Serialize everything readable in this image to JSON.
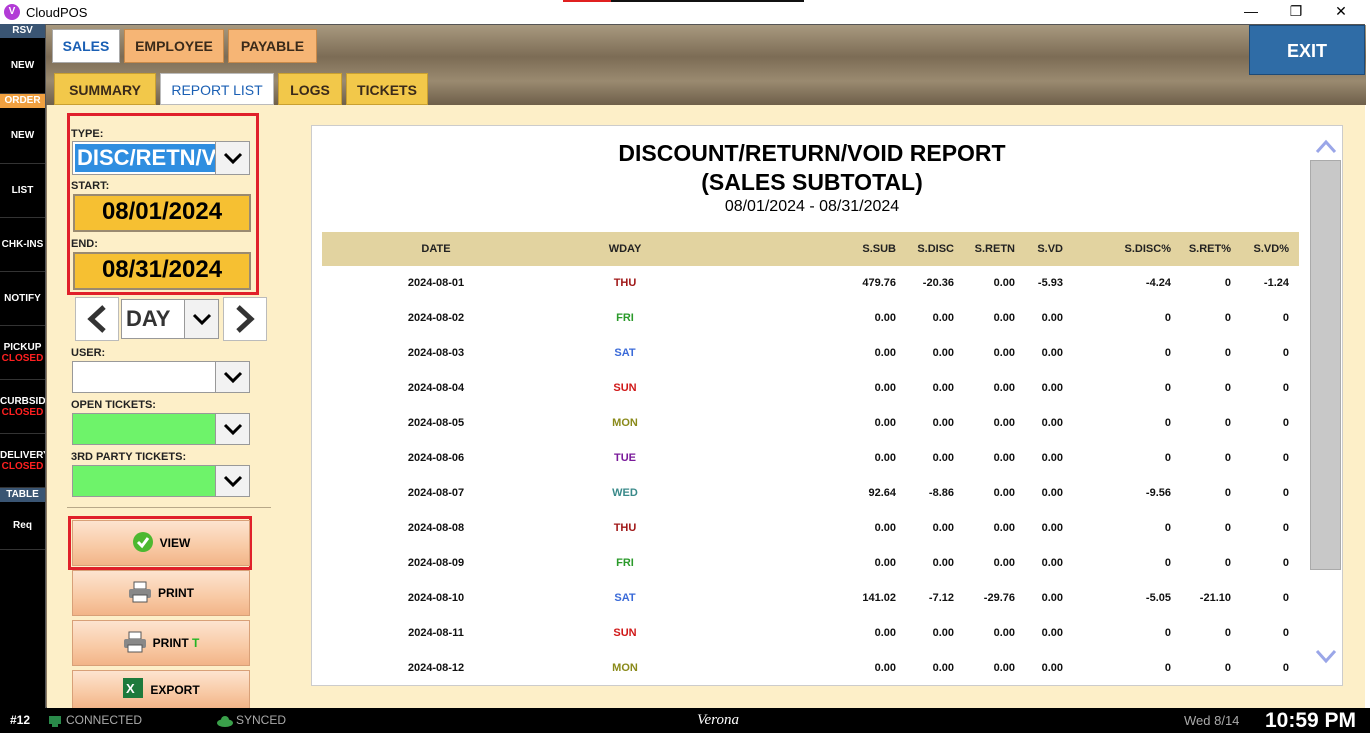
{
  "window": {
    "app_title": "CloudPOS",
    "app_icon_glyph": "V",
    "min_glyph": "—",
    "max_glyph": "❐",
    "close_glyph": "✕"
  },
  "leftbar": {
    "rsv_header": "RSV",
    "rsv_new": "NEW",
    "order_header": "ORDER",
    "items": [
      {
        "label": "NEW"
      },
      {
        "label": "LIST"
      },
      {
        "label": "CHK-INS"
      },
      {
        "label": "NOTIFY"
      },
      {
        "label": "PICKUP",
        "status": "CLOSED"
      },
      {
        "label": "CURBSID",
        "status": "CLOSED"
      },
      {
        "label": "DELIVERY",
        "status": "CLOSED"
      }
    ],
    "table_header": "TABLE",
    "req": "Req"
  },
  "top_tabs": [
    "SALES",
    "EMPLOYEE",
    "PAYABLE"
  ],
  "sub_tabs": [
    "SUMMARY",
    "REPORT LIST",
    "LOGS",
    "TICKETS"
  ],
  "exit_label": "EXIT",
  "filters": {
    "type_label": "TYPE:",
    "type_value": "DISC/RETN/VD",
    "start_label": "START:",
    "start_value": "08/01/2024",
    "end_label": "END:",
    "end_value": "08/31/2024",
    "period_value": "DAY",
    "user_label": "USER:",
    "open_tickets_label": "OPEN TICKETS:",
    "third_party_label": "3RD PARTY TICKETS:"
  },
  "actions": {
    "view": "VIEW",
    "print": "PRINT",
    "print_t_prefix": "PRINT",
    "print_t_suffix": "T",
    "export": "EXPORT"
  },
  "report": {
    "title_line1": "DISCOUNT/RETURN/VOID REPORT",
    "title_line2": "(SALES SUBTOTAL)",
    "range": "08/01/2024 - 08/31/2024",
    "columns": [
      "DATE",
      "WDAY",
      "S.SUB",
      "S.DISC",
      "S.RETN",
      "S.VD",
      "S.DISC%",
      "S.RET%",
      "S.VD%"
    ],
    "rows": [
      {
        "date": "2024-08-01",
        "wday": "THU",
        "sub": "479.76",
        "disc": "-20.36",
        "retn": "0.00",
        "vd": "-5.93",
        "discp": "-4.24",
        "retp": "0",
        "vdp": "-1.24"
      },
      {
        "date": "2024-08-02",
        "wday": "FRI",
        "sub": "0.00",
        "disc": "0.00",
        "retn": "0.00",
        "vd": "0.00",
        "discp": "0",
        "retp": "0",
        "vdp": "0"
      },
      {
        "date": "2024-08-03",
        "wday": "SAT",
        "sub": "0.00",
        "disc": "0.00",
        "retn": "0.00",
        "vd": "0.00",
        "discp": "0",
        "retp": "0",
        "vdp": "0"
      },
      {
        "date": "2024-08-04",
        "wday": "SUN",
        "sub": "0.00",
        "disc": "0.00",
        "retn": "0.00",
        "vd": "0.00",
        "discp": "0",
        "retp": "0",
        "vdp": "0"
      },
      {
        "date": "2024-08-05",
        "wday": "MON",
        "sub": "0.00",
        "disc": "0.00",
        "retn": "0.00",
        "vd": "0.00",
        "discp": "0",
        "retp": "0",
        "vdp": "0"
      },
      {
        "date": "2024-08-06",
        "wday": "TUE",
        "sub": "0.00",
        "disc": "0.00",
        "retn": "0.00",
        "vd": "0.00",
        "discp": "0",
        "retp": "0",
        "vdp": "0"
      },
      {
        "date": "2024-08-07",
        "wday": "WED",
        "sub": "92.64",
        "disc": "-8.86",
        "retn": "0.00",
        "vd": "0.00",
        "discp": "-9.56",
        "retp": "0",
        "vdp": "0"
      },
      {
        "date": "2024-08-08",
        "wday": "THU",
        "sub": "0.00",
        "disc": "0.00",
        "retn": "0.00",
        "vd": "0.00",
        "discp": "0",
        "retp": "0",
        "vdp": "0"
      },
      {
        "date": "2024-08-09",
        "wday": "FRI",
        "sub": "0.00",
        "disc": "0.00",
        "retn": "0.00",
        "vd": "0.00",
        "discp": "0",
        "retp": "0",
        "vdp": "0"
      },
      {
        "date": "2024-08-10",
        "wday": "SAT",
        "sub": "141.02",
        "disc": "-7.12",
        "retn": "-29.76",
        "vd": "0.00",
        "discp": "-5.05",
        "retp": "-21.10",
        "vdp": "0"
      },
      {
        "date": "2024-08-11",
        "wday": "SUN",
        "sub": "0.00",
        "disc": "0.00",
        "retn": "0.00",
        "vd": "0.00",
        "discp": "0",
        "retp": "0",
        "vdp": "0"
      },
      {
        "date": "2024-08-12",
        "wday": "MON",
        "sub": "0.00",
        "disc": "0.00",
        "retn": "0.00",
        "vd": "0.00",
        "discp": "0",
        "retp": "0",
        "vdp": "0"
      }
    ],
    "wday_colors": {
      "MON": "#8a8a1a",
      "TUE": "#7a1a9a",
      "WED": "#3a8a8a",
      "THU": "#a01818",
      "FRI": "#2a9a2a",
      "SAT": "#3a6ad8",
      "SUN": "#d01818"
    }
  },
  "status": {
    "terminal": "#12",
    "connected": "CONNECTED",
    "synced": "SYNCED",
    "store": "Verona",
    "date": "Wed 8/14",
    "time": "10:59 PM"
  },
  "colors": {
    "accent_blue": "#2f6ca6",
    "highlight_red": "#e0202a",
    "report_header": "#e2d3a0"
  }
}
